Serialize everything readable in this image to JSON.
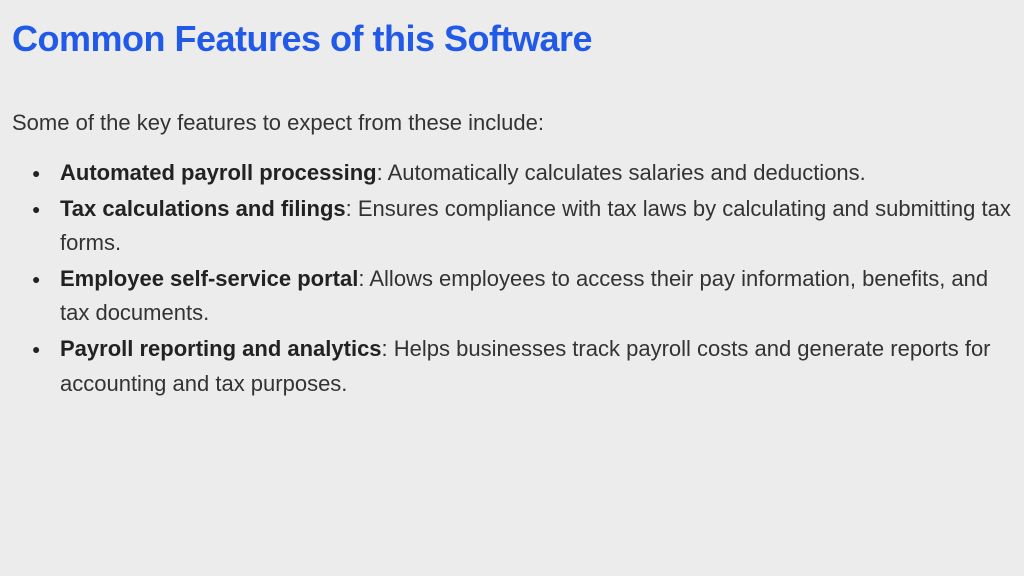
{
  "title": "Common Features of this Software",
  "intro": "Some of the key features to expect from these include:",
  "features": [
    {
      "title": "Automated payroll processing",
      "desc": ": Automatically calculates salaries and deductions."
    },
    {
      "title": "Tax calculations and filings",
      "desc": ": Ensures compliance with tax laws by calculating and submitting tax forms."
    },
    {
      "title": "Employee self-service portal",
      "desc": ": Allows employees to access their pay information, benefits, and tax documents."
    },
    {
      "title": "Payroll reporting and analytics",
      "desc": ": Helps businesses track payroll costs and generate reports for accounting and tax purposes."
    }
  ]
}
